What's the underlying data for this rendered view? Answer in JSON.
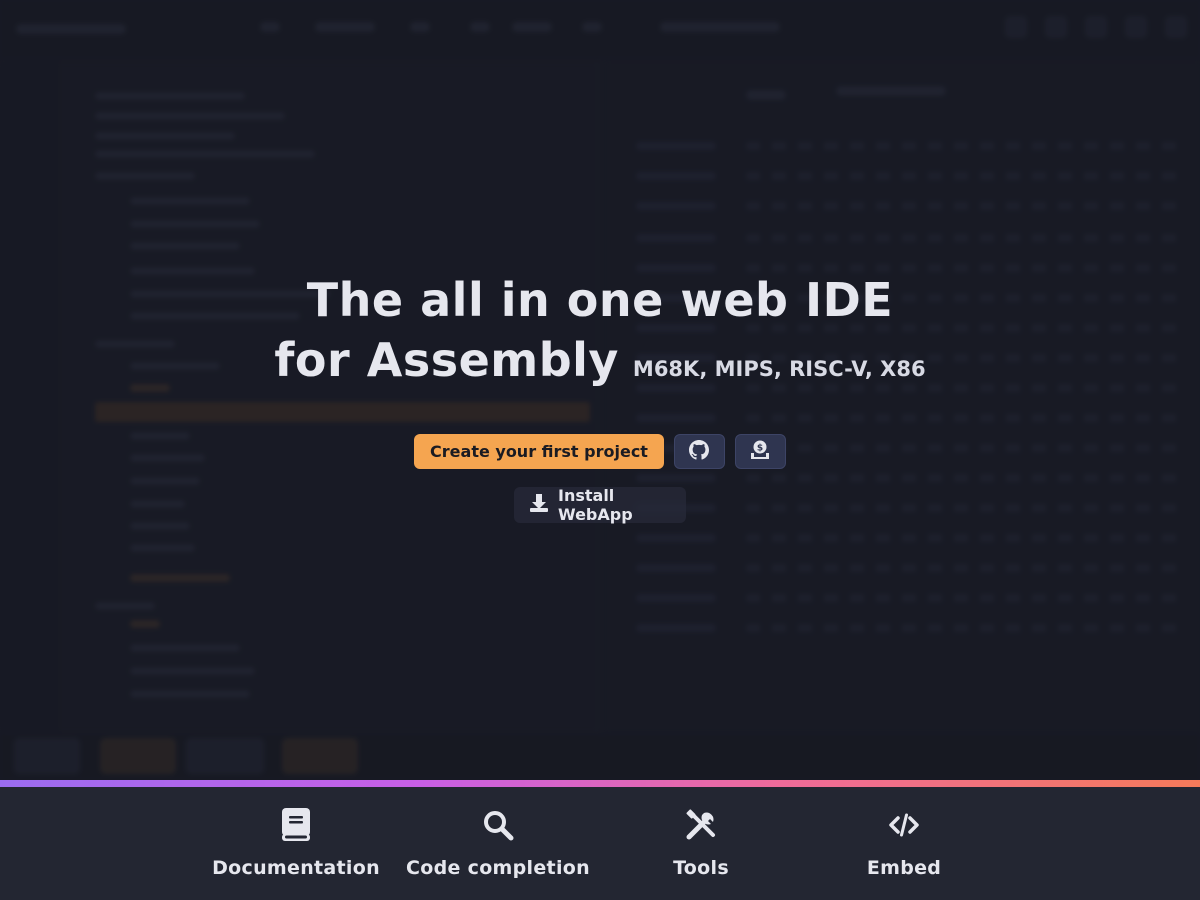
{
  "hero": {
    "title_line1": "The all in one web IDE",
    "title_line2": "for Assembly",
    "architectures": "M68K, MIPS, RISC-V, X86"
  },
  "actions": {
    "create_label": "Create your first project",
    "github_icon": "github-icon",
    "donate_icon": "donate-icon",
    "install_label": "Install WebApp",
    "install_icon": "download-icon"
  },
  "features": [
    {
      "label": "Documentation",
      "icon": "book-icon"
    },
    {
      "label": "Code completion",
      "icon": "search-icon"
    },
    {
      "label": "Tools",
      "icon": "tools-icon"
    },
    {
      "label": "Embed",
      "icon": "code-icon"
    }
  ],
  "colors": {
    "accent": "#f5a550",
    "background": "#1c1e29",
    "footer": "#232632",
    "gradient_start": "#9b6cf0",
    "gradient_end": "#f47a5a"
  }
}
